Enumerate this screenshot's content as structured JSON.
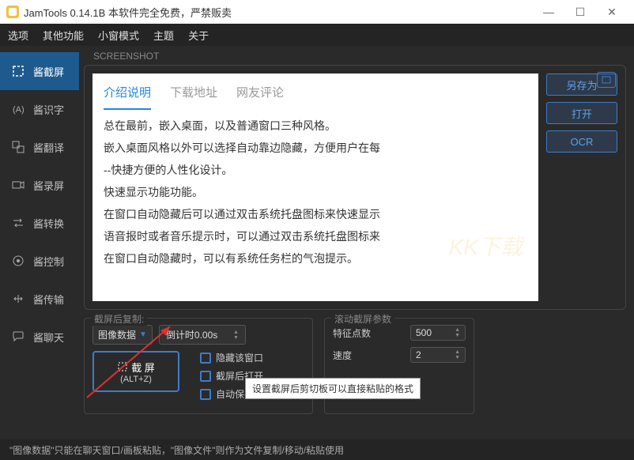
{
  "title": "JamTools 0.14.1B 本软件完全免费，严禁贩卖",
  "menu": [
    "选项",
    "其他功能",
    "小窗模式",
    "主题",
    "关于"
  ],
  "sidebar": [
    {
      "label": "酱截屏"
    },
    {
      "label": "酱识字"
    },
    {
      "label": "酱翻译"
    },
    {
      "label": "酱录屏"
    },
    {
      "label": "酱转换"
    },
    {
      "label": "酱控制"
    },
    {
      "label": "酱传输"
    },
    {
      "label": "酱聊天"
    }
  ],
  "panel_label": "SCREENSHOT",
  "preview": {
    "tabs": [
      "介绍说明",
      "下载地址",
      "网友评论"
    ],
    "lines": [
      "总在最前，嵌入桌面，以及普通窗口三种风格。",
      "嵌入桌面风格以外可以选择自动靠边隐藏，方便用户在每",
      "--快捷方便的人性化设计。",
      "快速显示功能功能。",
      "在窗口自动隐藏后可以通过双击系统托盘图标来快速显示",
      "语音报时或者音乐提示时，可以通过双击系统托盘图标来",
      "在窗口自动隐藏时，可以有系统任务栏的气泡提示。"
    ]
  },
  "actions": {
    "save_as": "另存为",
    "open": "打开",
    "ocr": "OCR"
  },
  "copy_group": {
    "title": "截屏后复制:",
    "format": "图像数据",
    "countdown": "倒计时0.00s",
    "big_btn": "截 屏",
    "big_btn_sub": "(ALT+Z)",
    "checks": [
      "隐藏该窗口",
      "截屏后打开",
      "自动保存文件"
    ]
  },
  "scroll_group": {
    "title": "滚动截屏参数",
    "feature_points": "特征点数",
    "feature_val": "500",
    "speed": "速度",
    "speed_val": "2"
  },
  "tooltip": "设置截屏后剪切板可以直接粘贴的格式",
  "statusbar": "\"图像数据\"只能在聊天窗口/画板粘贴，\"图像文件\"则作为文件复制/移动/粘贴使用"
}
